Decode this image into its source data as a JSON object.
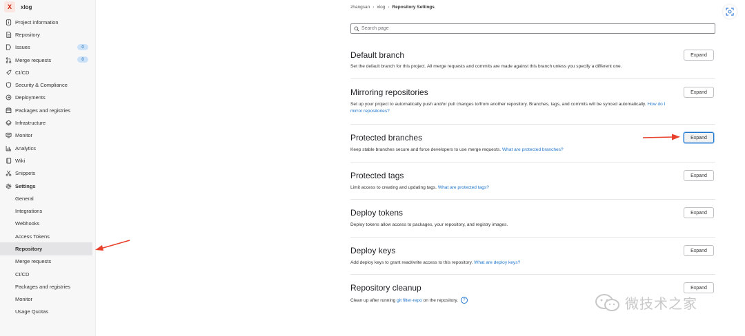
{
  "project": {
    "avatar_letter": "X",
    "name": "xlog"
  },
  "sidebar": {
    "items": [
      {
        "label": "Project information",
        "icon": "info-icon"
      },
      {
        "label": "Repository",
        "icon": "document-icon"
      },
      {
        "label": "Issues",
        "icon": "issues-icon",
        "badge": "0"
      },
      {
        "label": "Merge requests",
        "icon": "merge-request-icon",
        "badge": "0"
      },
      {
        "label": "CI/CD",
        "icon": "rocket-icon"
      },
      {
        "label": "Security & Compliance",
        "icon": "shield-icon"
      },
      {
        "label": "Deployments",
        "icon": "deployments-icon"
      },
      {
        "label": "Packages and registries",
        "icon": "package-icon"
      },
      {
        "label": "Infrastructure",
        "icon": "cloud-icon"
      },
      {
        "label": "Monitor",
        "icon": "monitor-icon"
      },
      {
        "label": "Analytics",
        "icon": "chart-icon"
      },
      {
        "label": "Wiki",
        "icon": "book-icon"
      },
      {
        "label": "Snippets",
        "icon": "scissors-icon"
      },
      {
        "label": "Settings",
        "icon": "gear-icon"
      }
    ],
    "settings_sub": [
      "General",
      "Integrations",
      "Webhooks",
      "Access Tokens",
      "Repository",
      "Merge requests",
      "CI/CD",
      "Packages and registries",
      "Monitor",
      "Usage Quotas"
    ]
  },
  "breadcrumb": {
    "user": "zhangsan",
    "project": "xlog",
    "current": "Repository Settings",
    "separator": "›"
  },
  "search": {
    "placeholder": "Search page"
  },
  "expand_label": "Expand",
  "sections": {
    "default_branch": {
      "title": "Default branch",
      "desc": "Set the default branch for this project. All merge requests and commits are made against this branch unless you specify a different one."
    },
    "mirroring": {
      "title": "Mirroring repositories",
      "desc": "Set up your project to automatically push and/or pull changes to/from another repository. Branches, tags, and commits will be synced automatically.",
      "link": "How do I mirror repositories?"
    },
    "protected_branches": {
      "title": "Protected branches",
      "desc": "Keep stable branches secure and force developers to use merge requests.",
      "link": "What are protected branches?"
    },
    "protected_tags": {
      "title": "Protected tags",
      "desc": "Limit access to creating and updating tags.",
      "link": "What are protected tags?"
    },
    "deploy_tokens": {
      "title": "Deploy tokens",
      "desc": "Deploy tokens allow access to packages, your repository, and registry images."
    },
    "deploy_keys": {
      "title": "Deploy keys",
      "desc": "Add deploy keys to grant read/write access to this repository.",
      "link": "What are deploy keys?"
    },
    "cleanup": {
      "title": "Repository cleanup",
      "desc_before": "Clean up after running",
      "code": "git filter-repo",
      "desc_after": "on the repository.",
      "help": "?"
    }
  },
  "watermark": {
    "text": "微技术之家"
  },
  "colors": {
    "link": "#1f75cb",
    "arrow": "#e8402a",
    "active_bg": "#e4e4e6"
  }
}
